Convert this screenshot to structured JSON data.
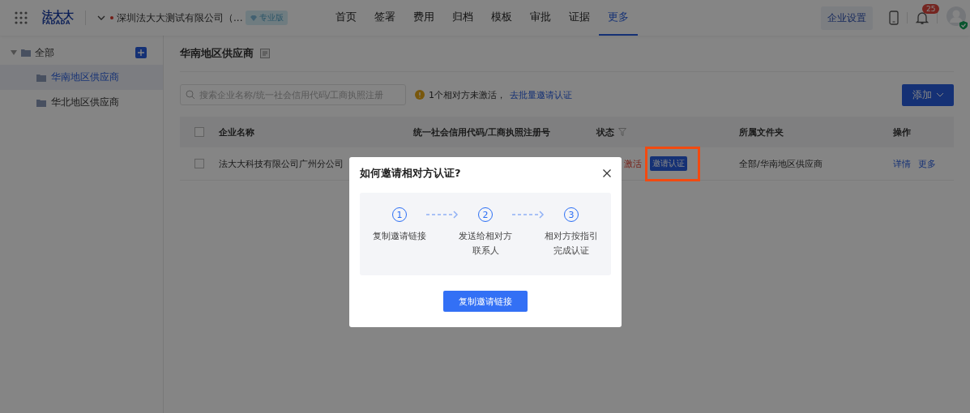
{
  "header": {
    "logo_cn": "法大大",
    "logo_en": "FADADA",
    "company": "深圳法大大测试有限公司（...",
    "edition": "专业版",
    "nav": [
      {
        "label": "首页",
        "selected": false
      },
      {
        "label": "签署",
        "selected": false
      },
      {
        "label": "费用",
        "selected": false
      },
      {
        "label": "归档",
        "selected": false
      },
      {
        "label": "模板",
        "selected": false
      },
      {
        "label": "审批",
        "selected": false
      },
      {
        "label": "证据",
        "selected": false
      },
      {
        "label": "更多",
        "selected": true
      }
    ],
    "settings_button": "企业设置",
    "notification_count": "25"
  },
  "sidebar": {
    "items": [
      {
        "label": "全部",
        "expanded": true,
        "selected": false,
        "children": [
          {
            "label": "华南地区供应商",
            "selected": true
          },
          {
            "label": "华北地区供应商",
            "selected": false
          }
        ]
      }
    ]
  },
  "main": {
    "title": "华南地区供应商",
    "search": {
      "placeholder": "搜索企业名称/统一社会信用代码/工商执照注册"
    },
    "notice": "1个相对方未激活，",
    "notice_link": "去批量邀请认证",
    "add_button": "添加",
    "table": {
      "all_checked": false,
      "columns": [
        "企业名称",
        "统一社会信用代码/工商执照注册号",
        "状态",
        "所属文件夹",
        "操作"
      ],
      "rows": [
        {
          "name": "法大大科技有限公司广州分公司",
          "status": "激活",
          "invite_button": "邀请认证",
          "highlighted": true,
          "folder": "全部/华南地区供应商",
          "actions": [
            "详情",
            "更多"
          ],
          "checked": false
        }
      ]
    }
  },
  "dialog": {
    "title": "如何邀请相对方认证?",
    "steps": [
      {
        "number": "1",
        "lines": [
          "复制邀请链接"
        ]
      },
      {
        "number": "2",
        "lines": [
          "发送给相对方",
          "联系人"
        ]
      },
      {
        "number": "3",
        "lines": [
          "相对方按指引",
          "完成认证"
        ]
      }
    ],
    "button": "复制邀请链接"
  }
}
